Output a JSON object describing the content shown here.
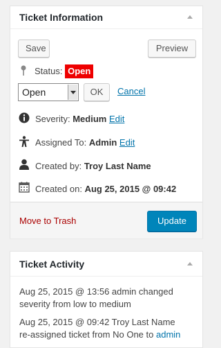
{
  "ticket_info": {
    "title": "Ticket Information",
    "save_label": "Save",
    "preview_label": "Preview",
    "status_label": "Status:",
    "status_value": "Open",
    "status_color": "#e00000",
    "status_select_value": "Open",
    "ok_label": "OK",
    "cancel_label": "Cancel",
    "severity_label": "Severity:",
    "severity_value": "Medium",
    "severity_edit": "Edit",
    "assigned_label": "Assigned To:",
    "assigned_value": "Admin",
    "assigned_edit": "Edit",
    "created_by_label": "Created by:",
    "created_by_value": "Troy Last Name",
    "created_on_label": "Created on:",
    "created_on_value": "Aug 25, 2015 @ 09:42",
    "trash_label": "Move to Trash",
    "update_label": "Update",
    "accent_color": "#0085ba"
  },
  "ticket_activity": {
    "title": "Ticket Activity",
    "entries": [
      {
        "line1": "Aug 25, 2015 @ 13:56 admin changed",
        "line2": "severity from low to medium"
      },
      {
        "line1": "Aug 25, 2015 @ 09:42 Troy Last Name",
        "line2_prefix": "re-assigned ticket from No One to ",
        "line2_link": "admin"
      }
    ]
  },
  "icons": [
    "pin-icon",
    "info-icon",
    "assign-person-icon",
    "user-icon",
    "calendar-icon",
    "collapse-arrow-icon",
    "dropdown-arrow-icon"
  ]
}
